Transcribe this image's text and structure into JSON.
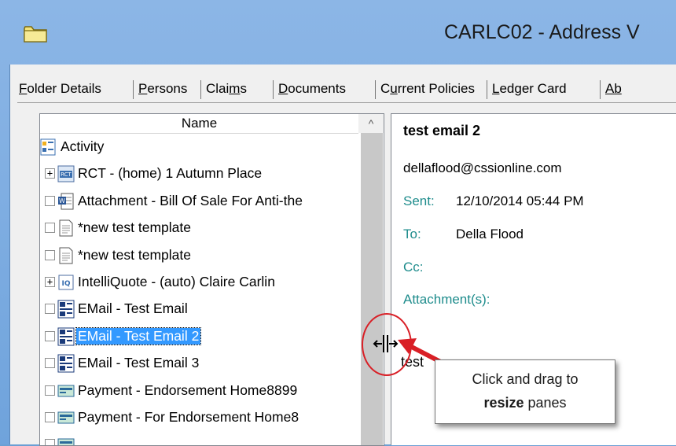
{
  "window": {
    "title": "CARLC02 - Address V",
    "icon": "folder-icon"
  },
  "tabs": [
    {
      "pre": "",
      "ul": "F",
      "post": "older Details"
    },
    {
      "pre": "",
      "ul": "P",
      "post": "ersons"
    },
    {
      "pre": "Clai",
      "ul": "m",
      "post": "s"
    },
    {
      "pre": "",
      "ul": "D",
      "post": "ocuments"
    },
    {
      "pre": "C",
      "ul": "u",
      "post": "rrent Policies"
    },
    {
      "pre": "",
      "ul": "L",
      "post": "edger Card"
    },
    {
      "pre": "",
      "ul": "Ab",
      "post": ""
    }
  ],
  "list": {
    "column_header": "Name",
    "sort_indicator": "^",
    "items": [
      {
        "label": "Activity",
        "icon": "activity-icon",
        "control": "none"
      },
      {
        "label": "RCT - (home) 1 Autumn Place",
        "icon": "rct-policy-icon",
        "control": "expander"
      },
      {
        "label": "Attachment - Bill Of Sale For Anti-the",
        "icon": "word-document-icon",
        "control": "checkbox"
      },
      {
        "label": "*new test template",
        "icon": "document-icon",
        "control": "checkbox"
      },
      {
        "label": "*new test template",
        "icon": "document-icon",
        "control": "checkbox"
      },
      {
        "label": "IntelliQuote - (auto) Claire Carlin",
        "icon": "intelliquote-icon",
        "control": "expander"
      },
      {
        "label": "EMail - Test Email",
        "icon": "email-icon",
        "control": "checkbox"
      },
      {
        "label": "EMail - Test Email 2",
        "icon": "email-icon",
        "control": "checkbox",
        "selected": true
      },
      {
        "label": "EMail - Test Email 3",
        "icon": "email-icon",
        "control": "checkbox"
      },
      {
        "label": "Payment - Endorsement Home8899",
        "icon": "payment-icon",
        "control": "checkbox"
      },
      {
        "label": "Payment - For Endorsement Home8",
        "icon": "payment-icon",
        "control": "checkbox"
      },
      {
        "label": "",
        "icon": "payment-icon",
        "control": "checkbox"
      }
    ],
    "expander_symbol": "+"
  },
  "preview": {
    "subject": "test email 2",
    "from": "dellaflood@cssionline.com",
    "sent_label": "Sent:",
    "sent_value": "12/10/2014 05:44 PM",
    "to_label": "To:",
    "to_value": "Della Flood",
    "cc_label": "Cc:",
    "attachments_label": "Attachment(s):",
    "body": "test"
  },
  "annotation": {
    "line1": "Click and drag to",
    "line2_bold": "resize",
    "line2_rest": " panes",
    "color": "#d91f26"
  },
  "colors": {
    "selection": "#3399ff",
    "label_teal": "#1e8c8c",
    "titlebar": "#8cb6e6"
  }
}
